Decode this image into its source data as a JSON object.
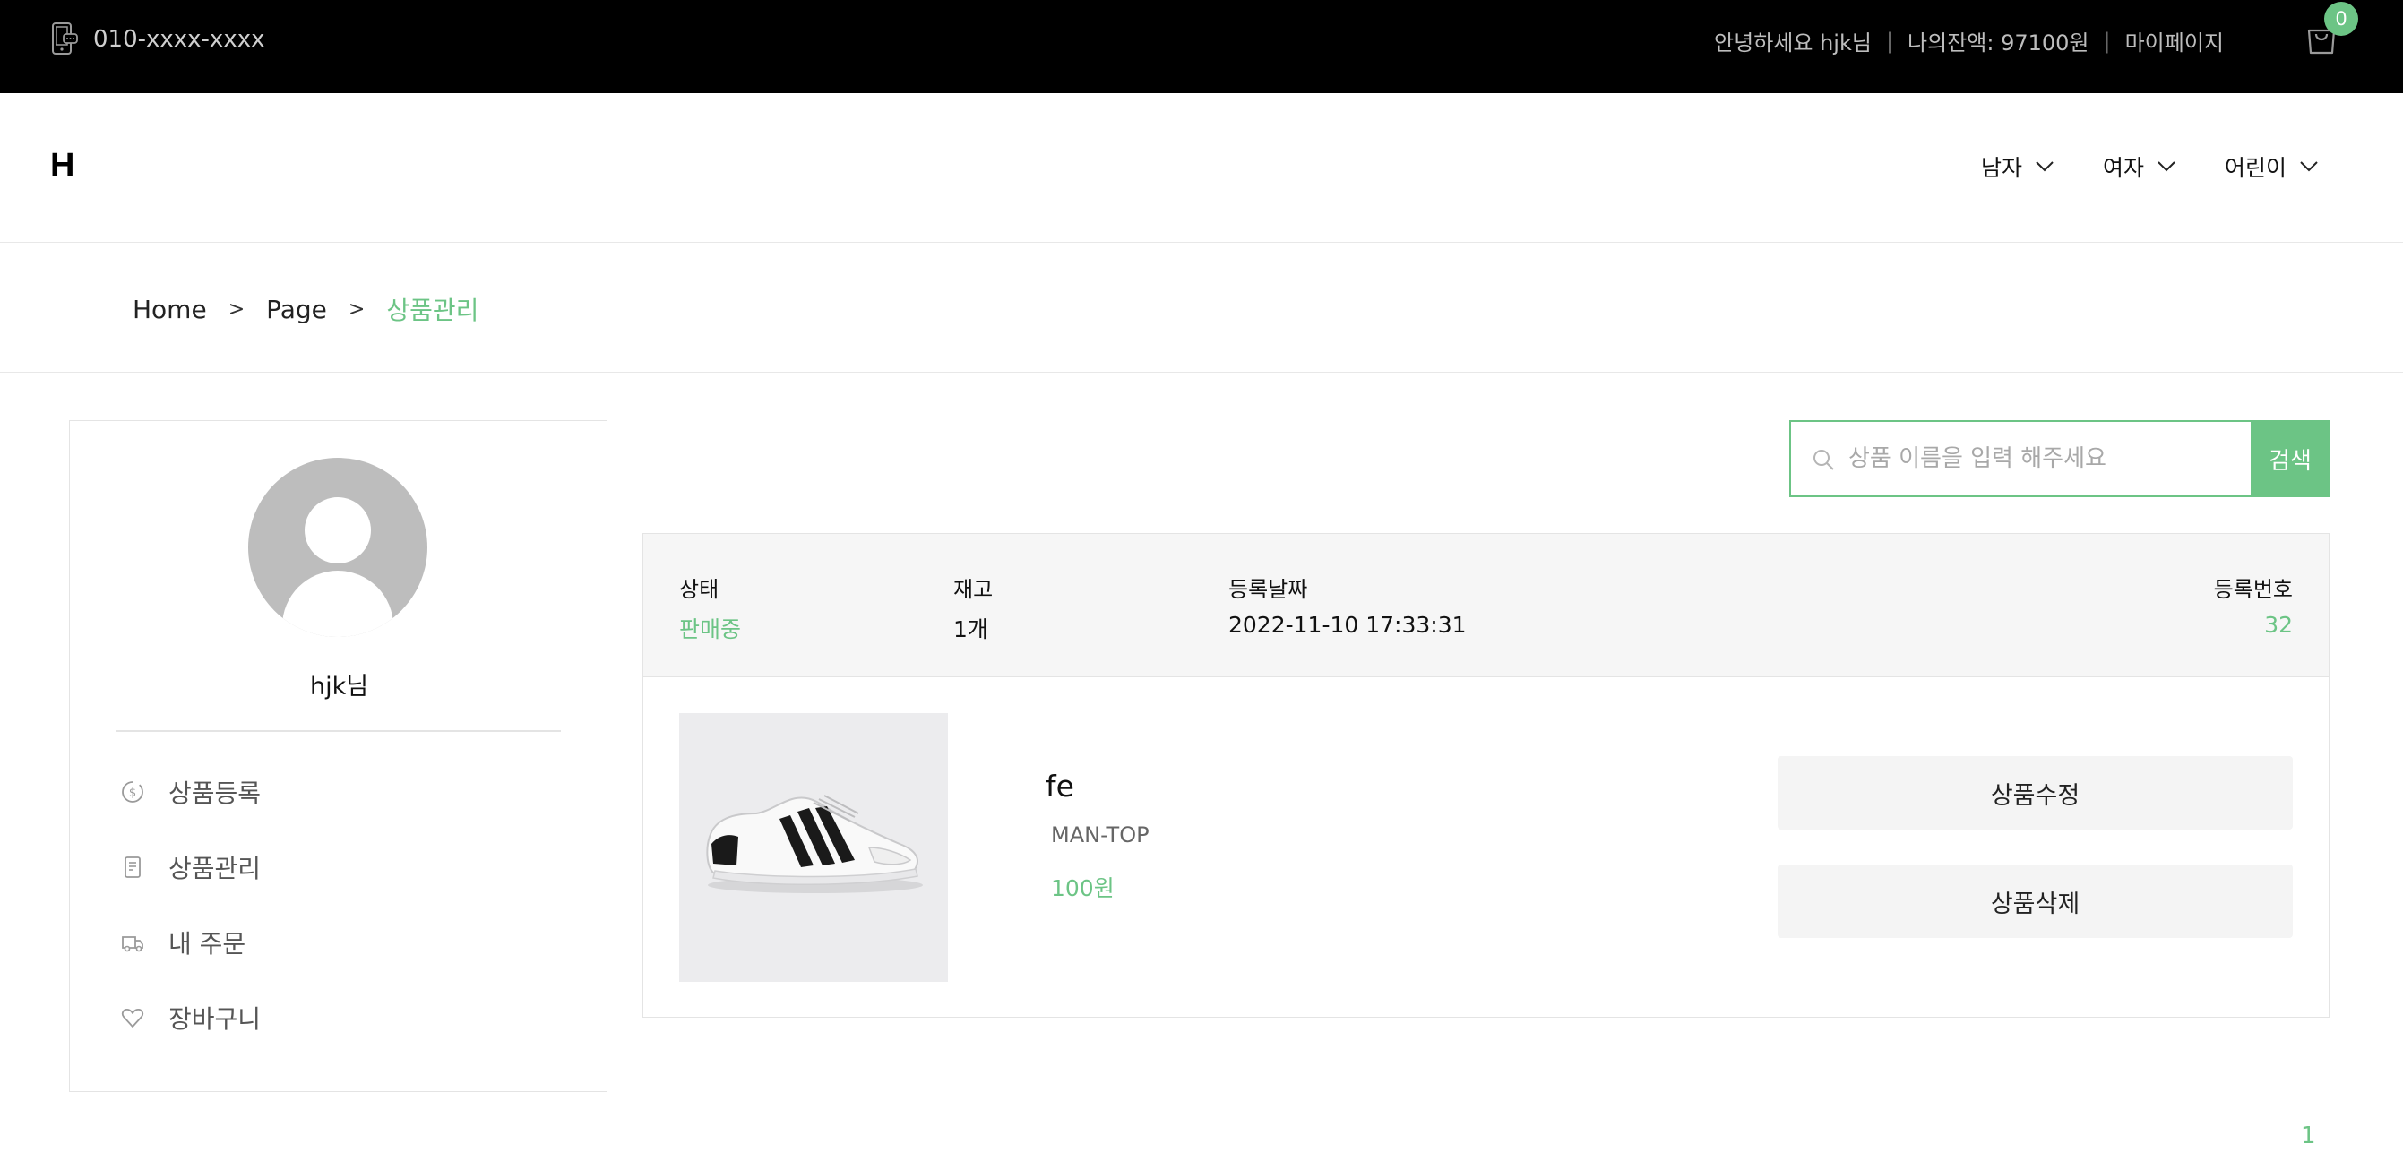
{
  "topbar": {
    "phone": "010-xxxx-xxxx",
    "greeting": "안녕하세요 hjk님",
    "balance": "나의잔액: 97100원",
    "mypage": "마이페이지",
    "cart_count": "0"
  },
  "header": {
    "logo": "H",
    "nav": [
      {
        "label": "남자"
      },
      {
        "label": "여자"
      },
      {
        "label": "어린이"
      }
    ]
  },
  "breadcrumb": {
    "items": [
      "Home",
      "Page"
    ],
    "current": "상품관리",
    "separator": ">"
  },
  "sidebar": {
    "username": "hjk님",
    "menu": [
      {
        "label": "상품등록",
        "icon": "coin-icon"
      },
      {
        "label": "상품관리",
        "icon": "receipt-icon"
      },
      {
        "label": "내 주문",
        "icon": "delivery-truck-icon"
      },
      {
        "label": "장바구니",
        "icon": "heart-icon"
      }
    ]
  },
  "search": {
    "placeholder": "상품 이름을 입력 해주세요",
    "button": "검색"
  },
  "product": {
    "status_label": "상태",
    "status_value": "판매중",
    "stock_label": "재고",
    "stock_value": "1개",
    "date_label": "등록날짜",
    "date_value": "2022-11-10 17:33:31",
    "id_label": "등록번호",
    "id_value": "32",
    "name": "fe",
    "category": "MAN-TOP",
    "price": "100원",
    "edit_button": "상품수정",
    "delete_button": "상품삭제"
  },
  "pagination": {
    "current": "1"
  },
  "colors": {
    "accent": "#6cc485",
    "topbar_bg": "#000000",
    "info_bg": "#f6f6f6",
    "button_bg": "#f4f4f4"
  }
}
